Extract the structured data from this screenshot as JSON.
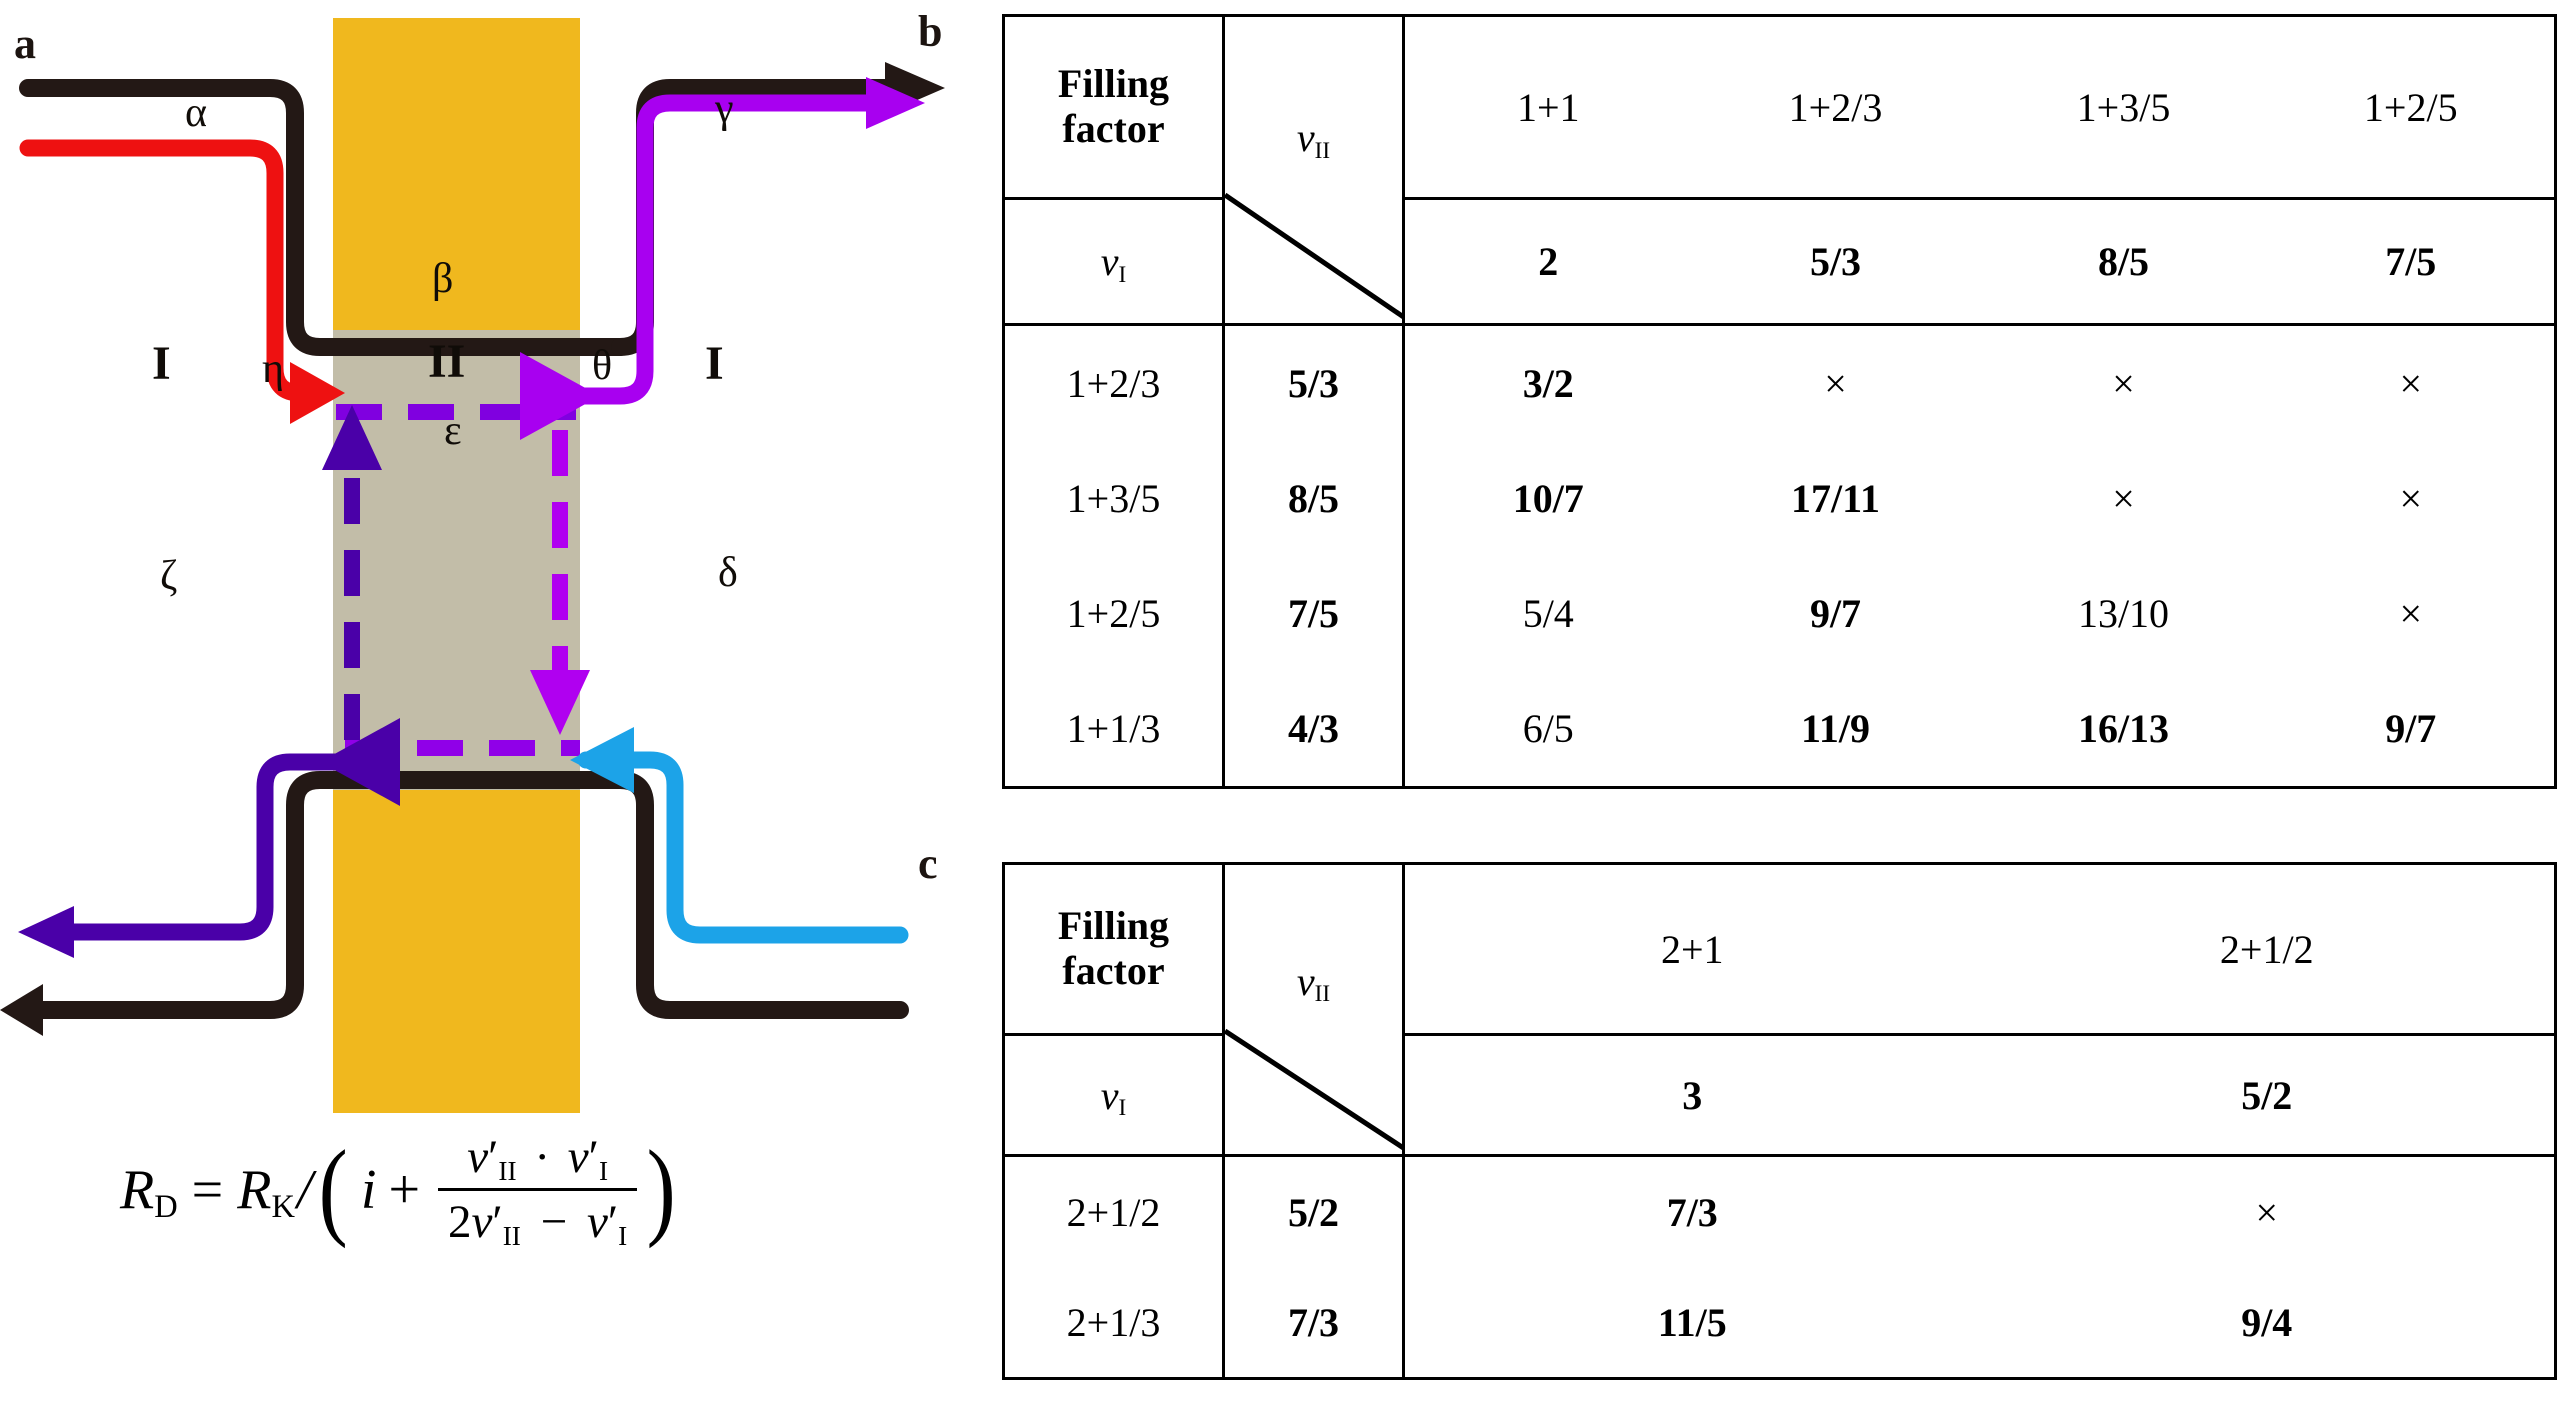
{
  "panels": {
    "a": {
      "label": "a",
      "region_labels": {
        "left_I": "I",
        "middle_II": "II",
        "right_I": "I"
      },
      "edge_labels": {
        "alpha": "α",
        "gamma": "γ",
        "beta": "β",
        "eta": "η",
        "theta": "θ",
        "epsilon": "ε",
        "zeta": "ζ",
        "delta": "δ"
      },
      "colors": {
        "gate": "#F0B81E",
        "region_II": "#C2BDA8",
        "black_edge": "#231815",
        "red_edge": "#EE1111",
        "magenta_edge": "#C400CC",
        "violet_edge": "#A800F0",
        "dark_violet_edge": "#4A00A8",
        "blue_edge": "#1CA3E8"
      },
      "formula": {
        "lhs_symbol": "R",
        "lhs_sub": "D",
        "equals": "=",
        "rk_symbol": "R",
        "rk_sub": "K",
        "slash": "/",
        "open_paren": "(",
        "i_symbol": "i",
        "plus": "+",
        "numerator": "ν′II · ν′I",
        "denominator": "2ν′II − ν′I",
        "close_paren": ")",
        "num_parts": {
          "nu1": "ν",
          "sub1": "II",
          "dot": "·",
          "nu2": "ν",
          "sub2": "I"
        },
        "den_parts": {
          "two": "2",
          "nu1": "ν",
          "sub1": "II",
          "minus": "−",
          "nu2": "ν",
          "sub2": "I"
        },
        "full_text": "R_D = R_K/(i + (ν′_II · ν′_I)/(2ν′_II − ν′_I))"
      }
    },
    "b": {
      "label": "b",
      "corner_title_line1": "Filling",
      "corner_title_line2": "factor",
      "col_head_symbol": "ν",
      "col_head_sub": "II",
      "row_head_symbol": "ν",
      "row_head_sub": "I",
      "columns_top": [
        "1+1",
        "1+2/3",
        "1+3/5",
        "1+2/5"
      ],
      "columns_bottom": [
        "2",
        "5/3",
        "8/5",
        "7/5"
      ],
      "rows": [
        {
          "filling": "1+2/3",
          "nu": "5/3",
          "cells": [
            {
              "text": "3/2",
              "style": "red"
            },
            {
              "text": "×",
              "style": "cross"
            },
            {
              "text": "×",
              "style": "cross"
            },
            {
              "text": "×",
              "style": "cross"
            }
          ]
        },
        {
          "filling": "1+3/5",
          "nu": "8/5",
          "cells": [
            {
              "text": "10/7",
              "style": "red"
            },
            {
              "text": "17/11",
              "style": "red"
            },
            {
              "text": "×",
              "style": "cross"
            },
            {
              "text": "×",
              "style": "cross"
            }
          ]
        },
        {
          "filling": "1+2/5",
          "nu": "7/5",
          "cells": [
            {
              "text": "5/4",
              "style": "gray"
            },
            {
              "text": "9/7",
              "style": "red"
            },
            {
              "text": "13/10",
              "style": "gray"
            },
            {
              "text": "×",
              "style": "cross"
            }
          ]
        },
        {
          "filling": "1+1/3",
          "nu": "4/3",
          "cells": [
            {
              "text": "6/5",
              "style": "gray"
            },
            {
              "text": "11/9",
              "style": "red"
            },
            {
              "text": "16/13",
              "style": "red"
            },
            {
              "text": "9/7",
              "style": "red"
            }
          ]
        }
      ]
    },
    "c": {
      "label": "c",
      "corner_title_line1": "Filling",
      "corner_title_line2": "factor",
      "col_head_symbol": "ν",
      "col_head_sub": "II",
      "row_head_symbol": "ν",
      "row_head_sub": "I",
      "columns_top": [
        "2+1",
        "2+1/2"
      ],
      "columns_bottom": [
        "3",
        "5/2"
      ],
      "rows": [
        {
          "filling": "2+1/2",
          "nu": "5/2",
          "cells": [
            {
              "text": "7/3",
              "style": "red"
            },
            {
              "text": "×",
              "style": "cross"
            }
          ]
        },
        {
          "filling": "2+1/3",
          "nu": "7/3",
          "cells": [
            {
              "text": "11/5",
              "style": "red"
            },
            {
              "text": "9/4",
              "style": "red"
            }
          ]
        }
      ]
    }
  },
  "colors": {
    "red_value": "#FF0000",
    "gray_value": "#B3B3B3",
    "border": "#000000"
  }
}
